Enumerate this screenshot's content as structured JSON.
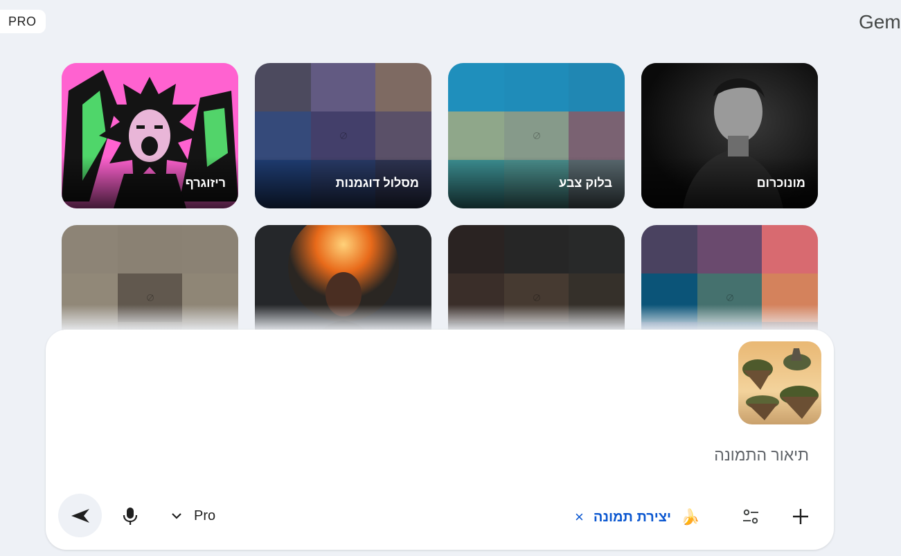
{
  "header": {
    "app_title": "Gemini",
    "plan_badge": "PRO"
  },
  "gallery": {
    "row1": [
      {
        "label": "מונוכרום"
      },
      {
        "label": "בלוק צבע"
      },
      {
        "label": "מסלול דוגמנות"
      },
      {
        "label": "ריזוגרף"
      }
    ]
  },
  "composer": {
    "placeholder": "תיאור התמונה",
    "tool_chip": {
      "label": "יצירת תמונה",
      "emoji": "🍌",
      "remove": "×"
    },
    "model": {
      "label": "Pro"
    }
  },
  "icons": [
    "plus-icon",
    "tools-icon",
    "banana-icon",
    "close-icon",
    "chevron-down-icon",
    "mic-icon",
    "send-icon"
  ]
}
